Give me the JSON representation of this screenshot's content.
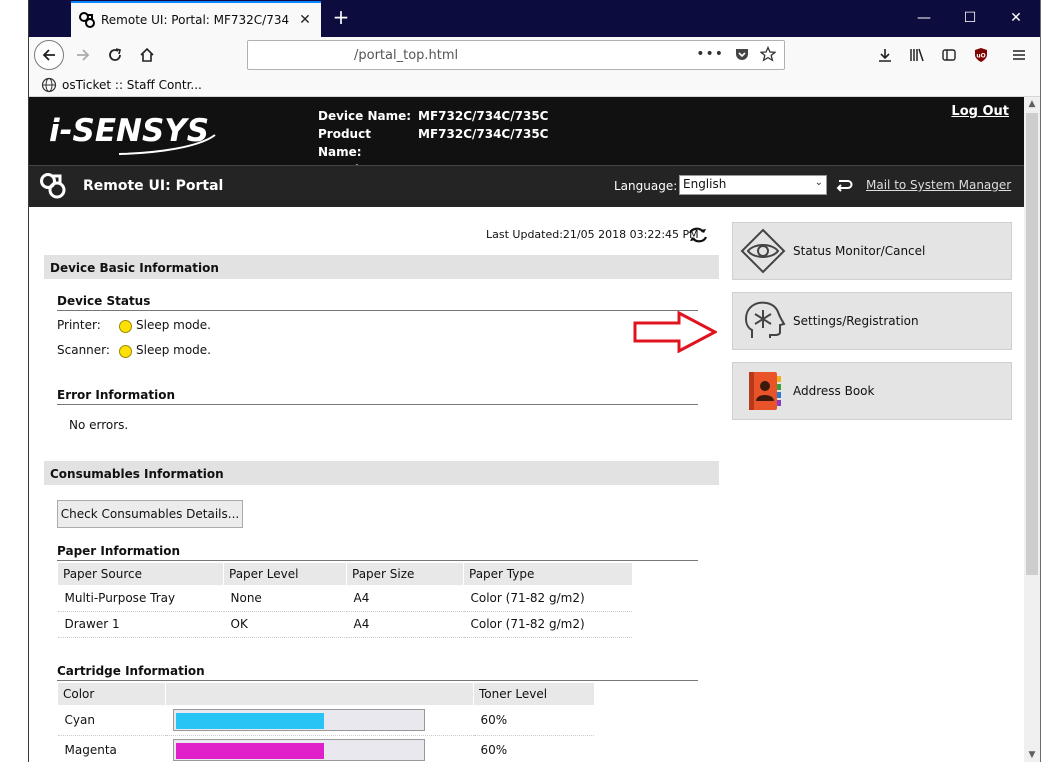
{
  "browser": {
    "tab_title": "Remote UI: Portal: MF732C/734",
    "url_text": "/portal_top.html",
    "bookmark_label": "osTicket :: Staff Contr..."
  },
  "header": {
    "logo_text": "i-SENSYS",
    "device_name_label": "Device Name:",
    "device_name_value": "MF732C/734C/735C",
    "product_name_label": "Product Name:",
    "product_name_value": "MF732C/734C/735C",
    "location_label": "Location:",
    "location_value": "",
    "logout_label": "Log Out",
    "portal_title": "Remote UI: Portal",
    "language_label": "Language:",
    "language_value": "English",
    "mail_link": "Mail to System Manager"
  },
  "main": {
    "last_updated": "Last Updated:21/05 2018 03:22:45 PM",
    "device_basic_title": "Device Basic Information",
    "device_status_title": "Device Status",
    "printer_label": "Printer:",
    "printer_status": "Sleep mode.",
    "scanner_label": "Scanner:",
    "scanner_status": "Sleep mode.",
    "error_title": "Error Information",
    "error_text": "No errors.",
    "consumables_title": "Consumables Information",
    "check_button": "Check Consumables Details...",
    "paper_title": "Paper Information",
    "paper_headers": [
      "Paper Source",
      "Paper Level",
      "Paper Size",
      "Paper Type"
    ],
    "paper_rows": [
      [
        "Multi-Purpose Tray",
        "None",
        "A4",
        "Color (71-82 g/m2)"
      ],
      [
        "Drawer 1",
        "OK",
        "A4",
        "Color (71-82 g/m2)"
      ]
    ],
    "cartridge_title": "Cartridge Information",
    "cartridge_headers": [
      "Color",
      "",
      "Toner Level"
    ],
    "cartridges": [
      {
        "name": "Cyan",
        "level_text": "60%",
        "level": 0.6,
        "color": "#29c4f6"
      },
      {
        "name": "Magenta",
        "level_text": "60%",
        "level": 0.6,
        "color": "#e020c8"
      }
    ]
  },
  "menu": {
    "status_monitor": "Status Monitor/Cancel",
    "settings": "Settings/Registration",
    "address_book": "Address Book"
  },
  "colors": {
    "header_bg": "#111111",
    "bar_bg": "#242424",
    "tab_accent": "#0a84ff",
    "arrow": "#e0141e"
  }
}
